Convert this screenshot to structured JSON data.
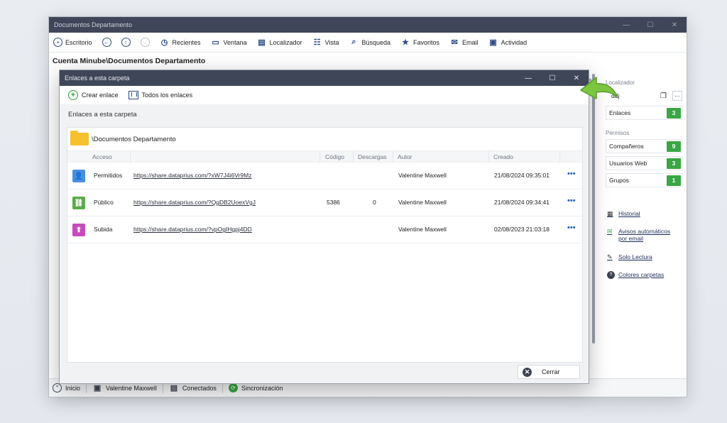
{
  "main_window": {
    "title": "Documentos Departamento",
    "controls": [
      "—",
      "☐",
      "✕"
    ]
  },
  "toolbar": {
    "escritorio": "Escritorio",
    "recientes": "Recientes",
    "ventana": "Ventana",
    "localizador": "Localizador",
    "vista": "Vista",
    "busqueda": "Búsqueda",
    "favoritos": "Favoritos",
    "email": "Email",
    "actividad": "Actividad"
  },
  "path": "Cuenta Minube\\Documentos Departamento",
  "side_panel": {
    "localizador_label": "Localizador",
    "localizador_value": "ddj",
    "enlaces_label": "Enlaces",
    "enlaces_count": "3",
    "permisos_label": "Permisos",
    "companeros_label": "Compañeros",
    "companeros_count": "9",
    "usuarios_web_label": "Usuarios Web",
    "usuarios_web_count": "3",
    "grupos_label": "Grupos",
    "grupos_count": "1",
    "historial": "Historial",
    "avisos_line1": "Avisos automáticos",
    "avisos_line2": "por email",
    "solo_lectura": "Solo Lectura",
    "colores": "Colores carpetas",
    "partial_s": "s"
  },
  "statusbar": {
    "inicio": "Inicio",
    "user": "Valentine Maxwell",
    "conectados": "Conectados",
    "sincronizacion": "Sincronización"
  },
  "dialog": {
    "title": "Enlaces a esta carpeta",
    "crear_enlace": "Crear enlace",
    "todos_enlaces": "Todos los enlaces",
    "subtitle": "Enlaces a esta carpeta",
    "folder": "\\Documentos Departamento",
    "columns": {
      "acceso": "Acceso",
      "codigo": "Código",
      "descargas": "Descargas",
      "autor": "Autor",
      "creado": "Creado"
    },
    "rows": [
      {
        "acceso": "Permitidos",
        "url": "https://share.dataprius.com/?xW7J4i6Vr9Mz",
        "codigo": "",
        "descargas": "",
        "autor": "Valentine Maxwell",
        "creado": "21/08/2024 09:35:01",
        "color": "#4a8ee0"
      },
      {
        "acceso": "Público",
        "url": "https://share.dataprius.com/?QgDB2UoexVgJ",
        "codigo": "5386",
        "descargas": "0",
        "autor": "Valentine Maxwell",
        "creado": "21/08/2024 09:34:41",
        "color": "#5aab4a"
      },
      {
        "acceso": "Subida",
        "url": "https://share.dataprius.com/?vpOgIHgpj4DD",
        "codigo": "",
        "descargas": "",
        "autor": "Valentine Maxwell",
        "creado": "02/08/2023 21:03:18",
        "color": "#c94ab8"
      }
    ],
    "more": "•••",
    "cerrar": "Cerrar"
  }
}
